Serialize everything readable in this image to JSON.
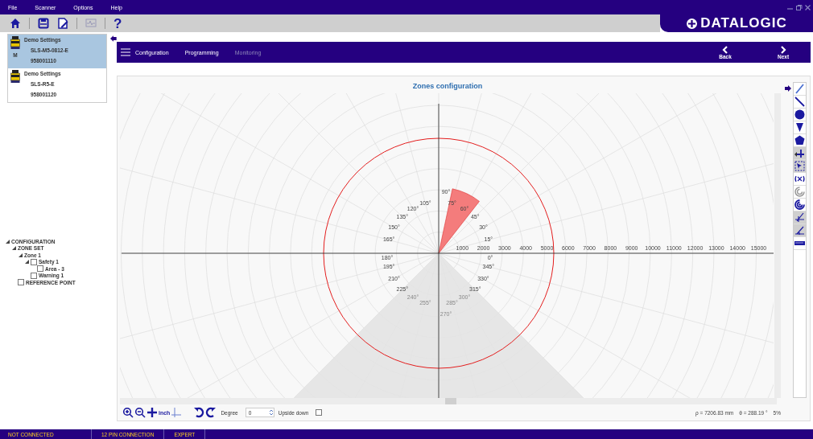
{
  "menu": [
    "File",
    "Scanner",
    "Options",
    "Help"
  ],
  "toolbar": {
    "help_glyph": "?"
  },
  "logo": {
    "text": "DATALOGIC"
  },
  "devices": [
    {
      "name": "Demo Settings",
      "model": "SLS-M5-0812-E",
      "badge": "M",
      "serial": "958001110",
      "selected": true
    },
    {
      "name": "Demo Settings",
      "model": "SLS-R5-E",
      "serial": "958001120",
      "selected": false
    }
  ],
  "tree": [
    {
      "label": "CONFIGURATION",
      "expanded": true,
      "children": [
        {
          "label": "ZONE SET",
          "expanded": true,
          "children": [
            {
              "label": "Zone 1",
              "expanded": true,
              "children": [
                {
                  "label": "Safety 1",
                  "expanded": true,
                  "checked": false,
                  "children": [
                    {
                      "label": "Area - 3",
                      "checked": false
                    }
                  ]
                },
                {
                  "label": "Warning 1",
                  "checked": false
                }
              ]
            }
          ]
        },
        {
          "label": "REFERENCE POINT",
          "checked": false
        }
      ]
    }
  ],
  "nav": {
    "tabs": [
      {
        "label": "Configuration",
        "disabled": false
      },
      {
        "label": "Programming",
        "disabled": false
      },
      {
        "label": "Monitoring",
        "disabled": true
      }
    ],
    "back": "Back",
    "next": "Next"
  },
  "plot": {
    "title": "Zones configuration",
    "radial_labels": [
      "1000",
      "2000",
      "3000",
      "4000",
      "5000",
      "6000",
      "7000",
      "8000",
      "9000",
      "10000",
      "11000",
      "12000",
      "13000",
      "14000",
      "15000"
    ],
    "angle_label_rows": [
      [
        "90°"
      ],
      [
        "105°",
        "75°"
      ],
      [
        "120°",
        "60°"
      ],
      [
        "135°",
        "45°"
      ],
      [
        "150°",
        "30°"
      ],
      [
        "165°",
        "15°"
      ],
      [
        "180°",
        "0°"
      ],
      [
        "195°",
        "345°"
      ],
      [
        "210°",
        "330°"
      ],
      [
        "225°",
        "315°"
      ],
      [
        "240°",
        "300°"
      ],
      [
        "255°",
        "285°"
      ],
      [
        "270°"
      ]
    ]
  },
  "bottom": {
    "unit": "inch",
    "degree_label": "Degree",
    "degree_value": "0",
    "upside_label": "Upside down",
    "upside_down": false,
    "rho": "ρ = 7206.83 mm",
    "theta": "θ = 288.19 °",
    "zoom": "5%"
  },
  "status": [
    "NOT CONNECTED",
    "12 PIN CONNECTION",
    "EXPERT"
  ]
}
